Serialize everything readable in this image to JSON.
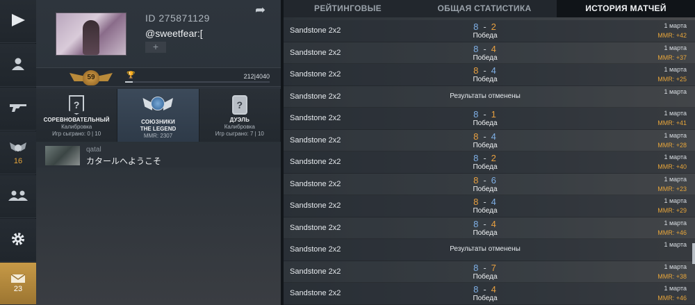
{
  "nav": {
    "items": [
      {
        "icon": "play-icon",
        "label": ""
      },
      {
        "icon": "user-icon",
        "label": ""
      },
      {
        "icon": "gun-icon",
        "label": ""
      },
      {
        "icon": "rank-wings-icon",
        "label": "16"
      },
      {
        "icon": "friends-icon",
        "label": ""
      },
      {
        "icon": "gear-icon",
        "label": ""
      },
      {
        "icon": "mail-icon",
        "label": "23"
      }
    ]
  },
  "profile": {
    "id": "ID 275871129",
    "nickname": "@sweetfear:[",
    "add_label": "+",
    "level": "59",
    "xp_text": "212|4040",
    "xp_fraction": 0.052
  },
  "modes": [
    {
      "title": "СОРЕВНОВАТЕЛЬНЫЙ",
      "sub": "Калибровка",
      "sub2": "Игр сыграно: 0 | 10"
    },
    {
      "title": "СОЮЗНИКИ",
      "sub": "THE LEGEND",
      "sub2": "MMR: 2307"
    },
    {
      "title": "ДУЭЛЬ",
      "sub": "Калибровка",
      "sub2": "Игр сыграно: 7 | 10"
    }
  ],
  "friend": {
    "name": "qatal",
    "status": "カタールへようこそ"
  },
  "tabs": {
    "ranked": "РЕЙТИНГОВЫЕ",
    "stats": "ОБЩАЯ СТАТИСТИКА",
    "history": "ИСТОРИЯ МАТЧЕЙ"
  },
  "matches": [
    {
      "map": "Sandstone 2x2",
      "a": "8",
      "b": "2",
      "a_orange": false,
      "b_orange": true,
      "result": "Победа",
      "date": "1 марта",
      "mmr": "MMR: +42"
    },
    {
      "map": "Sandstone 2x2",
      "a": "8",
      "b": "4",
      "a_orange": false,
      "b_orange": true,
      "result": "Победа",
      "date": "1 марта",
      "mmr": "MMR: +37"
    },
    {
      "map": "Sandstone 2x2",
      "a": "8",
      "b": "4",
      "a_orange": true,
      "b_orange": false,
      "result": "Победа",
      "date": "1 марта",
      "mmr": "MMR: +25"
    },
    {
      "map": "Sandstone 2x2",
      "cancelled": "Результаты отменены",
      "date": "1 марта",
      "mmr": ""
    },
    {
      "map": "Sandstone 2x2",
      "a": "8",
      "b": "1",
      "a_orange": false,
      "b_orange": true,
      "result": "Победа",
      "date": "1 марта",
      "mmr": "MMR: +41"
    },
    {
      "map": "Sandstone 2x2",
      "a": "8",
      "b": "4",
      "a_orange": true,
      "b_orange": false,
      "result": "Победа",
      "date": "1 марта",
      "mmr": "MMR: +28"
    },
    {
      "map": "Sandstone 2x2",
      "a": "8",
      "b": "2",
      "a_orange": false,
      "b_orange": true,
      "result": "Победа",
      "date": "1 марта",
      "mmr": "MMR: +40"
    },
    {
      "map": "Sandstone 2x2",
      "a": "8",
      "b": "6",
      "a_orange": true,
      "b_orange": false,
      "result": "Победа",
      "date": "1 марта",
      "mmr": "MMR: +23"
    },
    {
      "map": "Sandstone 2x2",
      "a": "8",
      "b": "4",
      "a_orange": true,
      "b_orange": false,
      "result": "Победа",
      "date": "1 марта",
      "mmr": "MMR: +29"
    },
    {
      "map": "Sandstone 2x2",
      "a": "8",
      "b": "4",
      "a_orange": false,
      "b_orange": true,
      "result": "Победа",
      "date": "1 марта",
      "mmr": "MMR: +46"
    },
    {
      "map": "Sandstone 2x2",
      "cancelled": "Результаты отменены",
      "date": "1 марта",
      "mmr": ""
    },
    {
      "map": "Sandstone 2x2",
      "a": "8",
      "b": "7",
      "a_orange": false,
      "b_orange": true,
      "result": "Победа",
      "date": "1 марта",
      "mmr": "MMR: +38"
    },
    {
      "map": "Sandstone 2x2",
      "a": "8",
      "b": "4",
      "a_orange": false,
      "b_orange": true,
      "result": "Победа",
      "date": "1 марта",
      "mmr": "MMR: +46"
    }
  ]
}
